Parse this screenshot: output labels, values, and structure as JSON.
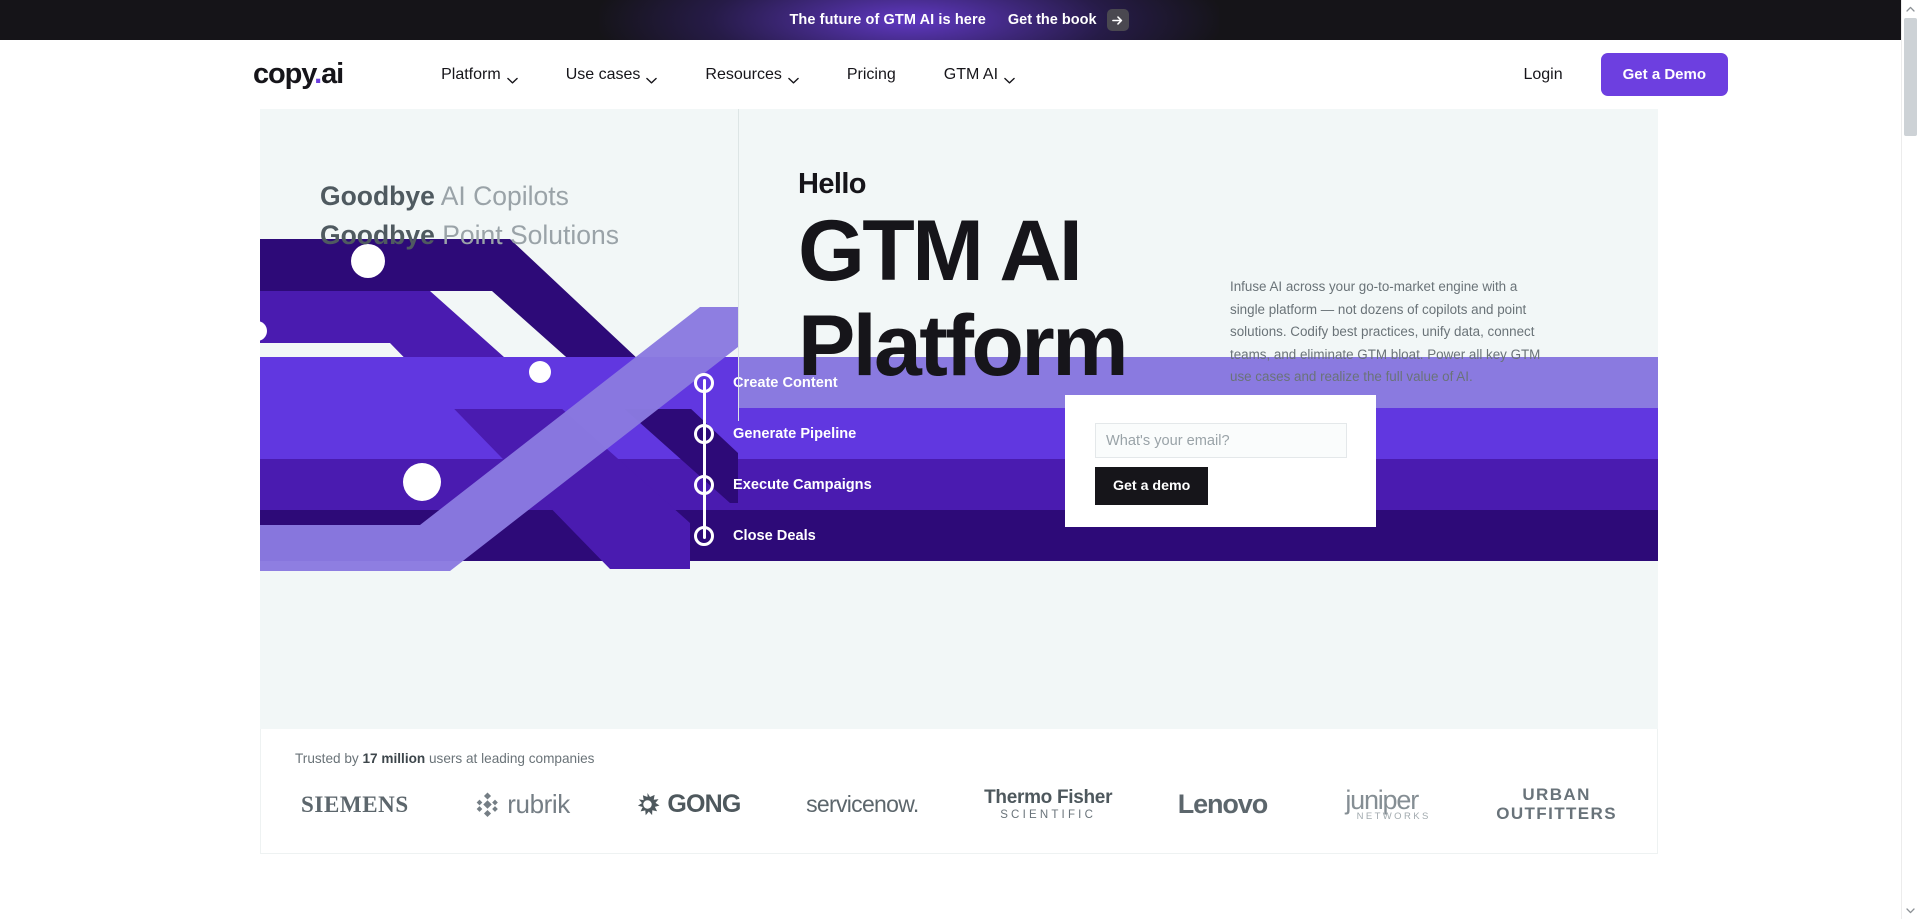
{
  "announcement": {
    "text": "The future of GTM AI is here",
    "link_label": "Get the book",
    "arrow_icon": "arrow-right-icon"
  },
  "header": {
    "logo": "copy",
    "logo_dot": ".",
    "logo_suffix": "ai",
    "nav": [
      {
        "label": "Platform",
        "has_chevron": true
      },
      {
        "label": "Use cases",
        "has_chevron": true
      },
      {
        "label": "Resources",
        "has_chevron": true
      },
      {
        "label": "Pricing",
        "has_chevron": false
      },
      {
        "label": "GTM AI",
        "has_chevron": true
      }
    ],
    "login_label": "Login",
    "demo_button_label": "Get a Demo",
    "accent_color": "#6d3fe0"
  },
  "hero": {
    "goodbye": [
      {
        "strong": "Goodbye",
        "rest": " AI Copilots"
      },
      {
        "strong": "Goodbye",
        "rest": " Point Solutions"
      }
    ],
    "hello_kicker": "Hello",
    "hello_line1": "GTM AI",
    "hello_line2": "Platform",
    "paragraph": "Infuse AI across your go-to-market engine with a single platform — not dozens of copilots and point solutions. Codify best practices, unify data, connect teams, and eliminate GTM bloat. Power all key GTM use cases and realize the full value of AI.",
    "steps": [
      {
        "label": "Create Content",
        "band_color": "#8a7ae0"
      },
      {
        "label": "Generate Pipeline",
        "band_color": "#6137e0"
      },
      {
        "label": "Execute Campaigns",
        "band_color": "#4a1bb0"
      },
      {
        "label": "Close Deals",
        "band_color": "#2d0a78"
      }
    ],
    "form": {
      "email_placeholder": "What's your email?",
      "email_value": "",
      "submit_label": "Get a demo"
    }
  },
  "trusted": {
    "prefix": "Trusted by ",
    "count": "17 million",
    "suffix": " users at leading companies",
    "logos": [
      {
        "name": "SIEMENS"
      },
      {
        "name": "rubrik"
      },
      {
        "name": "GONG"
      },
      {
        "name": "servicenow."
      },
      {
        "name": "Thermo Fisher",
        "sub": "SCIENTIFIC"
      },
      {
        "name": "Lenovo"
      },
      {
        "name": "juniper",
        "sub": "NETWORKS"
      },
      {
        "name": "URBAN",
        "sub": "OUTFITTERS"
      }
    ]
  },
  "scrollbar": {
    "up_icon": "chevron-up-icon",
    "down_icon": "chevron-down-icon"
  }
}
